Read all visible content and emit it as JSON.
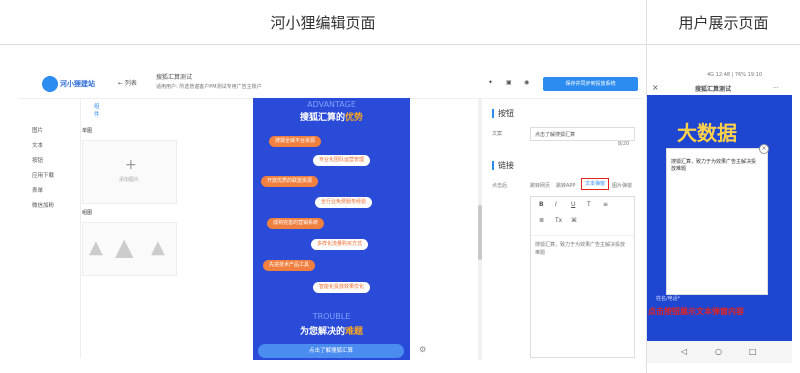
{
  "headers": {
    "left": "河小狸编辑页面",
    "right": "用户展示页面"
  },
  "editor": {
    "logo": "河小狸建站",
    "back_link": "← 列表",
    "page_name": "搜狐汇算测试",
    "page_desc": "适用用户: 所选普遍客户PM测试专用广告主账户",
    "publish_button": "保存并同步到投放系统",
    "left_tab": "组件",
    "left_items": [
      "图片",
      "文本",
      "按钮",
      "应用下载",
      "表单",
      "微信加粉"
    ],
    "comp_single": "单图",
    "comp_add": "添加图片",
    "comp_group": "组图",
    "phone": {
      "heading_en": "ADVANTAGE",
      "heading_cn_a": "搜狐汇算的",
      "heading_cn_b": "优势",
      "pills": [
        "搜狐全域平台资源",
        "专业化团队运营管理",
        "开放优质的联盟资源",
        "全行业免费服务经验",
        "成熟完善的营销系统",
        "多样化流量购买方式",
        "先进技术产品工具",
        "智能化投放效果优化"
      ],
      "heading_en2": "TROUBLE",
      "heading_cn2_a": "为您解决的",
      "heading_cn2_b": "难题",
      "cta": "点击了解搜狐汇算"
    },
    "props": {
      "section_button": "按钮",
      "copy_label": "文案",
      "copy_value": "点击了解搜狐汇算",
      "counter": "8/20",
      "section_link": "链接",
      "click_label": "点击后",
      "link_options": [
        "跳转网页",
        "跳转APP",
        "文本弹窗",
        "图片弹窗"
      ],
      "editor_text": "搜狐汇算，致力于为效果广告主解决投放难题"
    }
  },
  "preview": {
    "status": "4G 12:48 | 76% 19:10",
    "title": "搜狐汇算测试",
    "close": "×",
    "more": "···",
    "big_text": "大数据",
    "dialog_text": "搜狐汇算，致力于为效果广告主解决投放难题",
    "footer_label": "姓名/电话*",
    "note": "点击按钮展示文本弹窗内容",
    "nav": [
      "◁",
      "○",
      "□"
    ]
  },
  "colors": {
    "accent": "#2d8cf0",
    "phone_bg": "#2a4ad8",
    "pill": "#f08040",
    "note_red": "#e4231f"
  }
}
